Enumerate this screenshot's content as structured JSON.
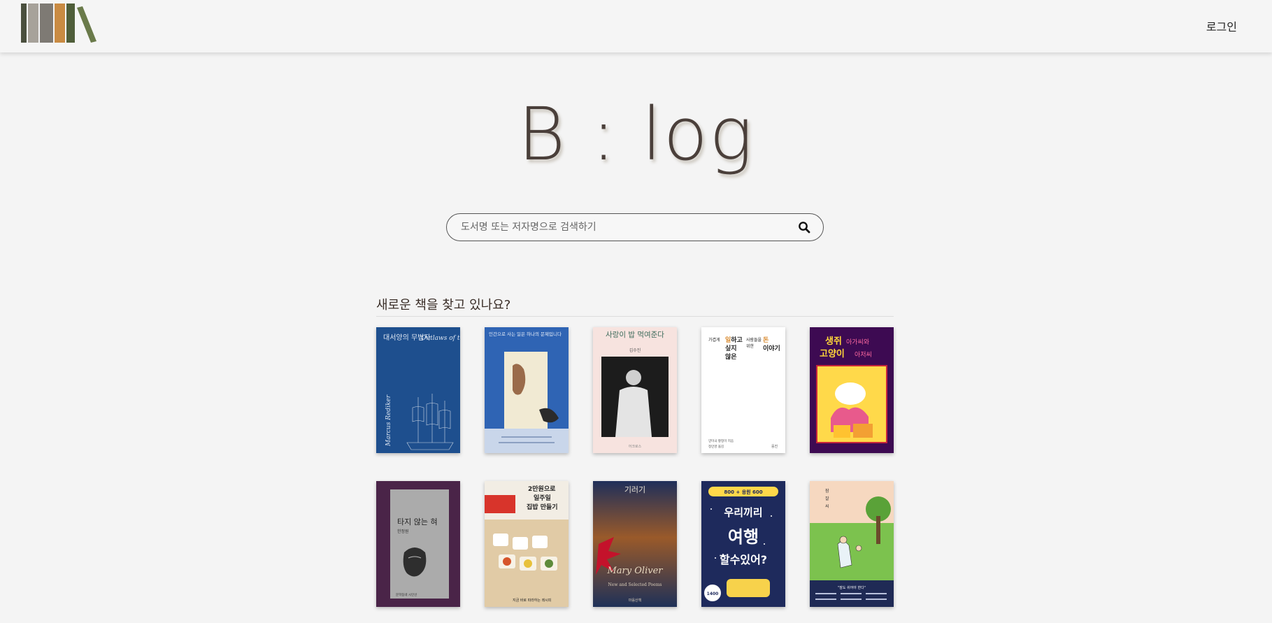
{
  "header": {
    "login_label": "로그인",
    "logo_colors": [
      "#4a4f3e",
      "#a7a29a",
      "#7e7a74",
      "#c98b43",
      "#4f5e3a",
      "#6a7a4a"
    ]
  },
  "hero": {
    "title": "B : log"
  },
  "search": {
    "placeholder": "도서명 또는 저자명으로 검색하기",
    "value": ""
  },
  "section": {
    "title": "새로운 책을 찾고 있나요?"
  },
  "books": [
    {
      "cover_title": "대서양의 무법자",
      "cover_subtitle": "Outlaws of the Atlantic",
      "cover_author": "Marcus Rediker"
    },
    {
      "cover_title": "인간으로 사는 일은 하나의 문제입니다",
      "cover_author": "김초엽"
    },
    {
      "cover_title": "사랑이 밥 먹여준다",
      "cover_author": "김수진"
    },
    {
      "cover_title": "가겹게 일하고 싶지 않은 사람들을 위한 돈 이야기"
    },
    {
      "cover_title": "생쥐 아가씨와 고양이 아저씨"
    },
    {
      "cover_title": "타지 않는 혀",
      "cover_author": "한정원"
    },
    {
      "cover_title": "2만원으로 일주일 집밥 만들기"
    },
    {
      "cover_title": "기러기",
      "cover_author": "Mary Oliver",
      "cover_subtitle": "New and Selected Poems"
    },
    {
      "cover_title": "우리끼리 여행 할 수 있어?",
      "cover_badge": "1400"
    },
    {
      "cover_title": "잠 잘 자는 씨"
    }
  ]
}
